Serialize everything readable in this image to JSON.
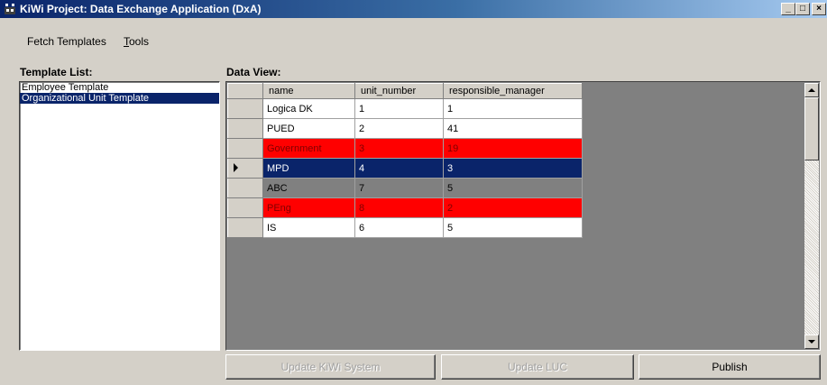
{
  "window": {
    "title": "KiWi Project: Data Exchange Application (DxA)",
    "controls": {
      "minimize": "_",
      "maximize": "□",
      "close": "×"
    }
  },
  "menu": {
    "fetch_templates": "Fetch Templates",
    "tools_first": "T",
    "tools_rest": "ools"
  },
  "template_list": {
    "label": "Template List:",
    "items": [
      "Employee Template",
      "Organizational Unit Template"
    ],
    "selected_index": 1
  },
  "data_view": {
    "label": "Data View:",
    "columns": [
      "name",
      "unit_number",
      "responsible_manager"
    ],
    "rows": [
      {
        "name": "Logica DK",
        "unit_number": "1",
        "responsible_manager": "1",
        "style": "white"
      },
      {
        "name": "PUED",
        "unit_number": "2",
        "responsible_manager": "41",
        "style": "white"
      },
      {
        "name": "Government",
        "unit_number": "3",
        "responsible_manager": "19",
        "style": "red"
      },
      {
        "name": "MPD",
        "unit_number": "4",
        "responsible_manager": "3",
        "style": "selected"
      },
      {
        "name": "ABC",
        "unit_number": "7",
        "responsible_manager": "5",
        "style": "gray"
      },
      {
        "name": "PEng",
        "unit_number": "8",
        "responsible_manager": "2",
        "style": "red"
      },
      {
        "name": "IS",
        "unit_number": "6",
        "responsible_manager": "5",
        "style": "white"
      }
    ]
  },
  "buttons": {
    "update_kiwi": "Update KiWi System",
    "update_luc": "Update LUC",
    "publish": "Publish"
  },
  "colors": {
    "title_bar": "#0a246a",
    "highlight_red": "#ff0000",
    "selection": "#0a246a"
  }
}
